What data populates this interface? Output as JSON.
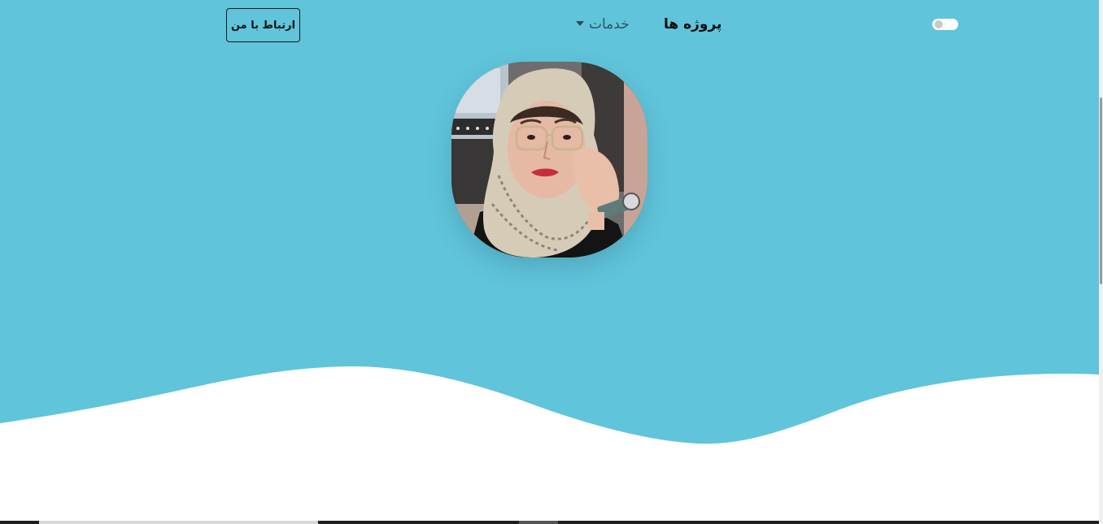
{
  "nav": {
    "contact_label": "ارتباط با من",
    "services_label": "خدمات",
    "projects_label": "پروژه ها",
    "theme_toggle_on": false
  },
  "hero": {
    "background_color": "#60c4da",
    "wave_color": "#ffffff"
  },
  "icons": {
    "services_caret": "caret-down-icon",
    "theme_toggle": "toggle-switch-icon"
  }
}
